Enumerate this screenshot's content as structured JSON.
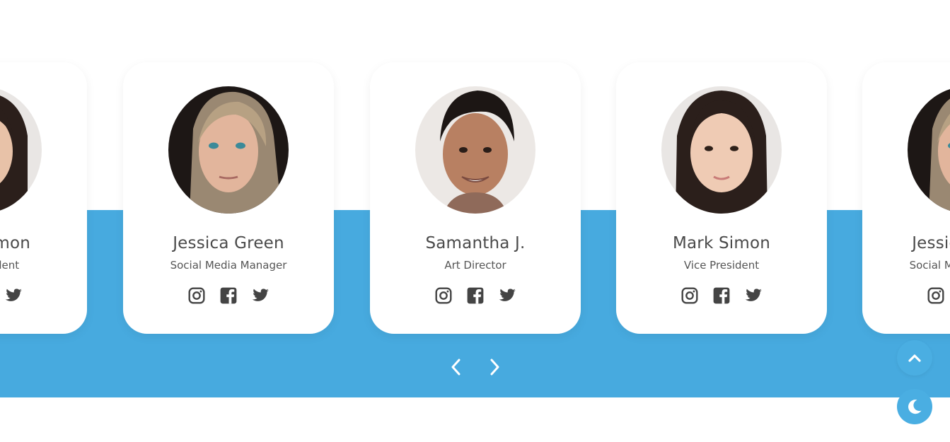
{
  "colors": {
    "band": "#47aadf",
    "card": "#ffffff",
    "text": "#4a4a4a",
    "icon": "#444444"
  },
  "carousel": {
    "cards": [
      {
        "name": "Mark Simon",
        "role": "Vice President",
        "avatar": "woman-dark-hair-photo"
      },
      {
        "name": "Jessica Green",
        "role": "Social Media Manager",
        "avatar": "woman-blonde-photo"
      },
      {
        "name": "Samantha J.",
        "role": "Art Director",
        "avatar": "man-smiling-photo"
      },
      {
        "name": "Mark Simon",
        "role": "Vice President",
        "avatar": "woman-dark-hair-photo"
      },
      {
        "name": "Jessica Green",
        "role": "Social Media Manager",
        "avatar": "woman-blonde-photo"
      }
    ],
    "social_icons": [
      "instagram-icon",
      "facebook-icon",
      "twitter-icon"
    ],
    "controls": {
      "prev_icon": "chevron-left-icon",
      "next_icon": "chevron-right-icon"
    }
  },
  "floating": {
    "scroll_top_icon": "chevron-up-icon",
    "theme_icon": "moon-icon"
  }
}
